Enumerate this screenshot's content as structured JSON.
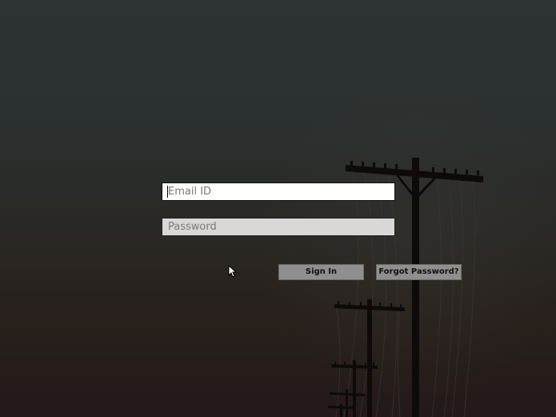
{
  "login_form": {
    "email_placeholder": "Email ID",
    "password_placeholder": "Password",
    "signin_label": "Sign In",
    "forgot_label": "Forgot Password?"
  },
  "icons": {
    "cursor": "mouse-pointer-icon",
    "background": "power-lines-silhouette"
  },
  "colors": {
    "email_bg": "#ffffff",
    "password_bg": "#d8d8d8",
    "button_bg": "#8f8f8f"
  }
}
